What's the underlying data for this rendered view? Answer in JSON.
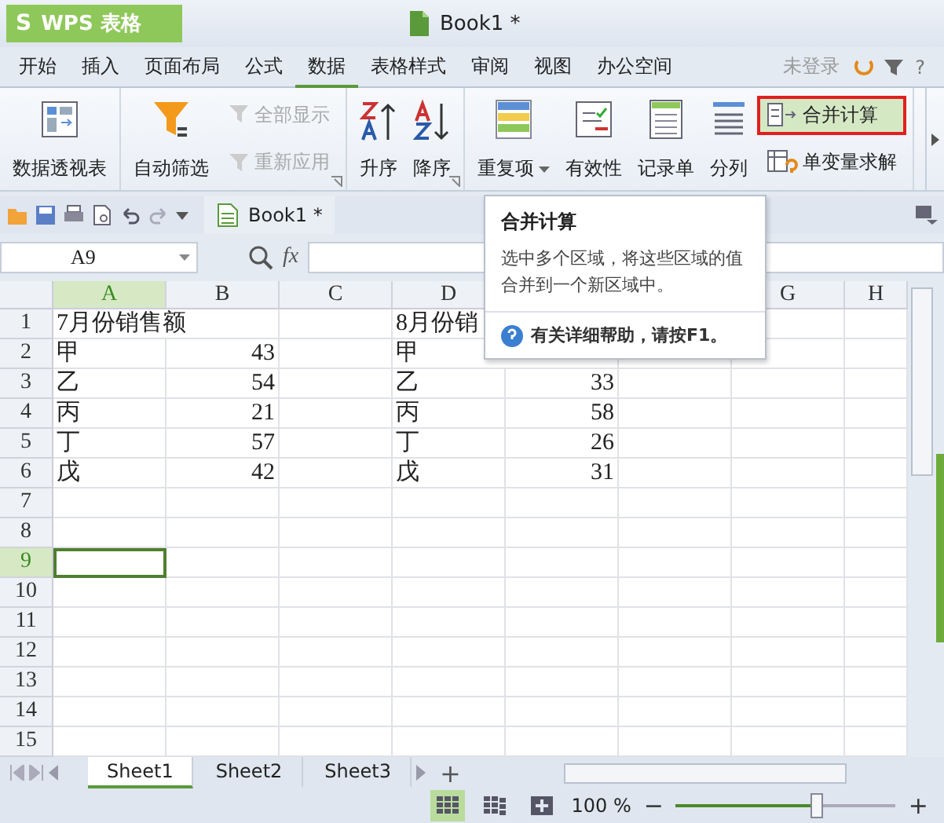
{
  "app": {
    "logo_mark": "S",
    "logo": "WPS 表格",
    "title": "Book1 *",
    "login": "未登录",
    "help": "?"
  },
  "menu": [
    {
      "label": "开始",
      "selected": false
    },
    {
      "label": "插入",
      "selected": false
    },
    {
      "label": "页面布局",
      "selected": false
    },
    {
      "label": "公式",
      "selected": false
    },
    {
      "label": "数据",
      "selected": true
    },
    {
      "label": "表格样式",
      "selected": false
    },
    {
      "label": "审阅",
      "selected": false
    },
    {
      "label": "视图",
      "selected": false
    },
    {
      "label": "办公空间",
      "selected": false
    }
  ],
  "ribbon": [
    {
      "launcher": false,
      "items": [
        {
          "kind": "large",
          "label": "数据透视表",
          "disabled": false,
          "highlighted": false,
          "dropdown": false
        }
      ]
    },
    {
      "launcher": true,
      "items": [
        {
          "kind": "large",
          "label": "自动筛选",
          "disabled": false,
          "highlighted": false,
          "dropdown": false
        },
        {
          "kind": "small",
          "label": "全部显示",
          "disabled": true,
          "highlighted": false,
          "dropdown": false
        },
        {
          "kind": "small",
          "label": "重新应用",
          "disabled": true,
          "highlighted": false,
          "dropdown": false
        }
      ]
    },
    {
      "launcher": true,
      "items": [
        {
          "kind": "large",
          "label": "升序",
          "disabled": false,
          "highlighted": false,
          "dropdown": false
        },
        {
          "kind": "large",
          "label": "降序",
          "disabled": false,
          "highlighted": false,
          "dropdown": false
        }
      ]
    },
    {
      "launcher": false,
      "items": [
        {
          "kind": "large",
          "label": "重复项",
          "disabled": false,
          "highlighted": false,
          "dropdown": true
        },
        {
          "kind": "large",
          "label": "有效性",
          "disabled": false,
          "highlighted": false,
          "dropdown": false
        },
        {
          "kind": "large",
          "label": "记录单",
          "disabled": false,
          "highlighted": false,
          "dropdown": false
        },
        {
          "kind": "large",
          "label": "分列",
          "disabled": false,
          "highlighted": false,
          "dropdown": false
        },
        {
          "kind": "small",
          "label": "合并计算",
          "disabled": false,
          "highlighted": true,
          "dropdown": false
        },
        {
          "kind": "small",
          "label": "单变量求解",
          "disabled": false,
          "highlighted": false,
          "dropdown": false
        }
      ]
    }
  ],
  "doc_tab": {
    "label": "Book1 *"
  },
  "formula_bar": {
    "name_box": "A9",
    "fx": "fx"
  },
  "columns": [
    {
      "label": "A",
      "selected": true
    },
    {
      "label": "B",
      "selected": false
    },
    {
      "label": "C",
      "selected": false
    },
    {
      "label": "D",
      "selected": false
    },
    null,
    null,
    {
      "label": "G",
      "selected": false
    },
    {
      "label": "H",
      "selected": false
    }
  ],
  "rows": [
    {
      "label": "1",
      "selected": false,
      "cells": [
        {
          "kind": "text",
          "text": "7月份销售额",
          "active": false
        },
        null,
        null,
        {
          "kind": "text",
          "text": "8月份销",
          "active": false
        },
        null,
        null,
        null,
        null
      ]
    },
    {
      "label": "2",
      "selected": false,
      "cells": [
        {
          "kind": "text",
          "text": "甲",
          "active": false
        },
        {
          "kind": "number",
          "text": "43",
          "active": false
        },
        null,
        {
          "kind": "text",
          "text": "甲",
          "active": false
        },
        null,
        null,
        null,
        null
      ]
    },
    {
      "label": "3",
      "selected": false,
      "cells": [
        {
          "kind": "text",
          "text": "乙",
          "active": false
        },
        {
          "kind": "number",
          "text": "54",
          "active": false
        },
        null,
        {
          "kind": "text",
          "text": "乙",
          "active": false
        },
        {
          "kind": "number",
          "text": "33",
          "active": false
        },
        null,
        null,
        null
      ]
    },
    {
      "label": "4",
      "selected": false,
      "cells": [
        {
          "kind": "text",
          "text": "丙",
          "active": false
        },
        {
          "kind": "number",
          "text": "21",
          "active": false
        },
        null,
        {
          "kind": "text",
          "text": "丙",
          "active": false
        },
        {
          "kind": "number",
          "text": "58",
          "active": false
        },
        null,
        null,
        null
      ]
    },
    {
      "label": "5",
      "selected": false,
      "cells": [
        {
          "kind": "text",
          "text": "丁",
          "active": false
        },
        {
          "kind": "number",
          "text": "57",
          "active": false
        },
        null,
        {
          "kind": "text",
          "text": "丁",
          "active": false
        },
        {
          "kind": "number",
          "text": "26",
          "active": false
        },
        null,
        null,
        null
      ]
    },
    {
      "label": "6",
      "selected": false,
      "cells": [
        {
          "kind": "text",
          "text": "戊",
          "active": false
        },
        {
          "kind": "number",
          "text": "42",
          "active": false
        },
        null,
        {
          "kind": "text",
          "text": "戊",
          "active": false
        },
        {
          "kind": "number",
          "text": "31",
          "active": false
        },
        null,
        null,
        null
      ]
    },
    {
      "label": "7",
      "selected": false,
      "cells": [
        null,
        null,
        null,
        null,
        null,
        null,
        null,
        null
      ]
    },
    {
      "label": "8",
      "selected": false,
      "cells": [
        null,
        null,
        null,
        null,
        null,
        null,
        null,
        null
      ]
    },
    {
      "label": "9",
      "selected": true,
      "cells": [
        {
          "kind": "empty",
          "active": true
        },
        null,
        null,
        null,
        null,
        null,
        null,
        null
      ]
    },
    {
      "label": "10",
      "selected": false,
      "cells": [
        null,
        null,
        null,
        null,
        null,
        null,
        null,
        null
      ]
    },
    {
      "label": "11",
      "selected": false,
      "cells": [
        null,
        null,
        null,
        null,
        null,
        null,
        null,
        null
      ]
    },
    {
      "label": "12",
      "selected": false,
      "cells": [
        null,
        null,
        null,
        null,
        null,
        null,
        null,
        null
      ]
    },
    {
      "label": "13",
      "selected": false,
      "cells": [
        null,
        null,
        null,
        null,
        null,
        null,
        null,
        null
      ]
    },
    {
      "label": "14",
      "selected": false,
      "cells": [
        null,
        null,
        null,
        null,
        null,
        null,
        null,
        null
      ]
    },
    {
      "label": "15",
      "selected": false,
      "cells": [
        null,
        null,
        null,
        null,
        null,
        null,
        null,
        null
      ]
    }
  ],
  "tooltip": {
    "title": "合并计算",
    "body": "选中多个区域，将这些区域的值合并到一个新区域中。",
    "help": "有关详细帮助，请按F1。"
  },
  "sheets": [
    {
      "label": "Sheet1",
      "selected": true
    },
    {
      "label": "Sheet2",
      "selected": false
    },
    {
      "label": "Sheet3",
      "selected": false
    }
  ],
  "add_sheet": "+",
  "status": {
    "views": [
      {
        "selected": true
      },
      {
        "selected": false
      },
      {
        "selected": false
      }
    ],
    "zoom": "100 %",
    "minus": "−",
    "plus": "+",
    "level": 0.64
  }
}
